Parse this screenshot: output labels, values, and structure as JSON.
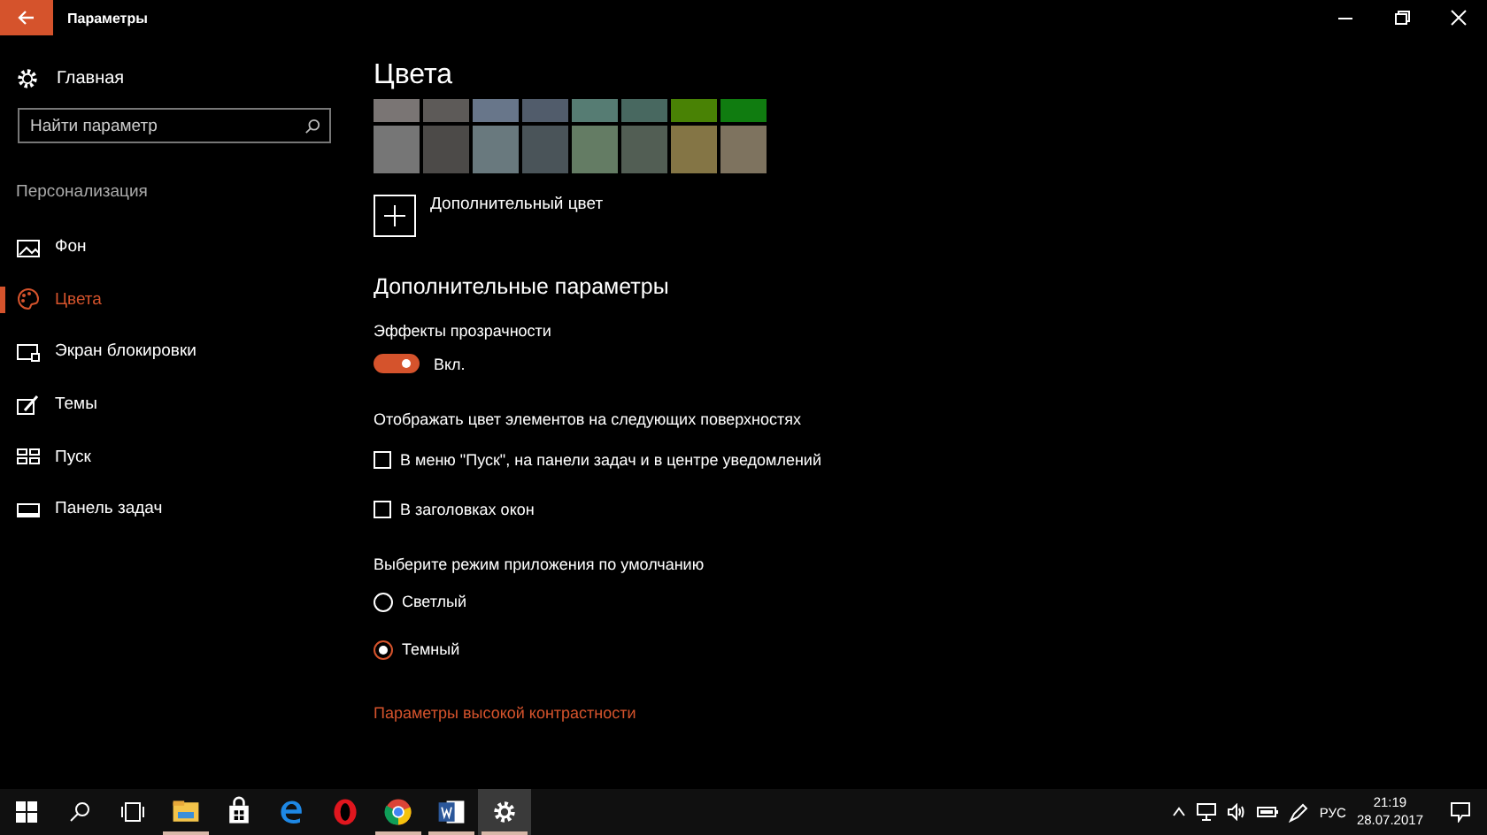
{
  "window": {
    "title": "Параметры"
  },
  "sidebar": {
    "home": "Главная",
    "search": {
      "placeholder": "Найти параметр"
    },
    "section": "Персонализация",
    "items": [
      {
        "label": "Фон",
        "kind": "picture",
        "selected": false
      },
      {
        "label": "Цвета",
        "kind": "palette",
        "selected": true
      },
      {
        "label": "Экран блокировки",
        "kind": "lock",
        "selected": false
      },
      {
        "label": "Темы",
        "kind": "themes",
        "selected": false
      },
      {
        "label": "Пуск",
        "kind": "start",
        "selected": false
      },
      {
        "label": "Панель задач",
        "kind": "taskbar",
        "selected": false
      }
    ]
  },
  "content": {
    "title": "Цвета",
    "swatches": [
      {
        "color": "#7a7574"
      },
      {
        "color": "#5d5a58"
      },
      {
        "color": "#68768a"
      },
      {
        "color": "#515c6b"
      },
      {
        "color": "#567c73"
      },
      {
        "color": "#486860"
      },
      {
        "color": "#498205"
      },
      {
        "color": "#107c10"
      },
      {
        "color": "#767676"
      },
      {
        "color": "#4c4a48"
      },
      {
        "color": "#69797e"
      },
      {
        "color": "#4a5459"
      },
      {
        "color": "#647c64"
      },
      {
        "color": "#525e54"
      },
      {
        "color": "#847545"
      },
      {
        "color": "#7e735f"
      }
    ],
    "custom_color": "Дополнительный цвет",
    "advanced_title": "Дополнительные параметры",
    "transparency": {
      "label": "Эффекты прозрачности",
      "on": true,
      "state": "Вкл."
    },
    "surfaces_label": "Отображать цвет элементов на следующих поверхностях",
    "checkboxes": [
      {
        "label": "В меню \"Пуск\", на панели задач и в центре уведомлений",
        "checked": false
      },
      {
        "label": "В заголовках окон",
        "checked": false
      }
    ],
    "mode_label": "Выберите режим приложения по умолчанию",
    "modes": [
      {
        "label": "Светлый",
        "selected": false
      },
      {
        "label": "Темный",
        "selected": true
      }
    ],
    "link": "Параметры высокой контрастности"
  },
  "taskbar": {
    "apps": [
      {
        "kind": "explorer",
        "running": true,
        "active": false
      },
      {
        "kind": "store",
        "running": false,
        "active": false
      },
      {
        "kind": "edge",
        "running": false,
        "active": false
      },
      {
        "kind": "opera",
        "running": false,
        "active": false
      },
      {
        "kind": "chrome",
        "running": true,
        "active": false
      },
      {
        "kind": "word",
        "running": true,
        "active": false
      },
      {
        "kind": "settings",
        "running": true,
        "active": true
      }
    ],
    "language": "РУС",
    "time": "21:19",
    "date": "28.07.2017"
  }
}
